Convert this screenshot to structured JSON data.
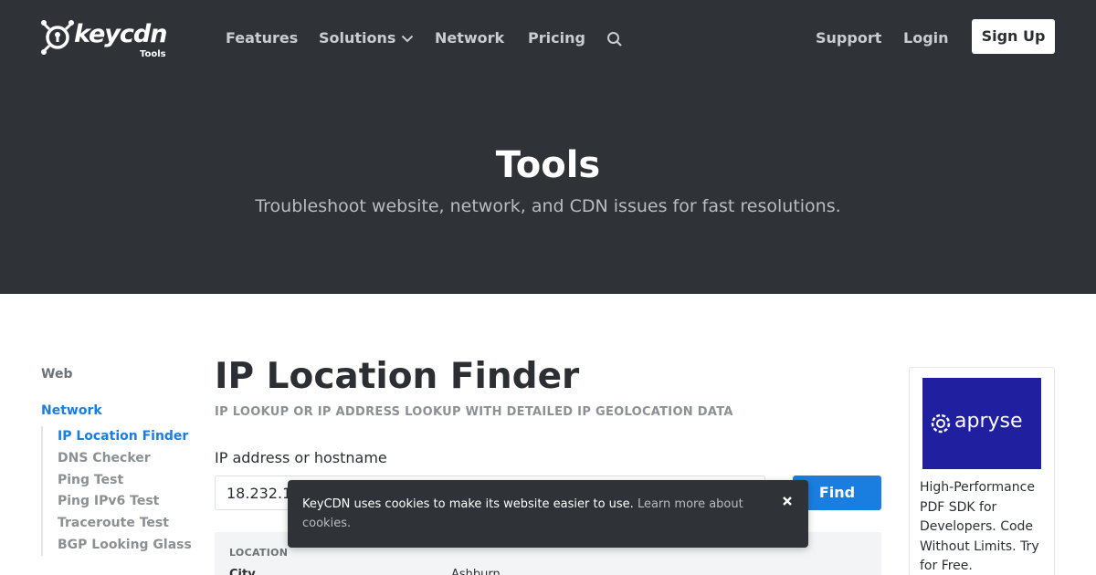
{
  "header": {
    "logo": {
      "name": "keycdn",
      "sub": "Tools"
    },
    "nav": [
      {
        "label": "Features"
      },
      {
        "label": "Solutions"
      },
      {
        "label": "Network"
      },
      {
        "label": "Pricing"
      }
    ],
    "right_nav": [
      {
        "label": "Support"
      },
      {
        "label": "Login"
      }
    ],
    "signup_label": "Sign Up",
    "icons": {
      "search": "search-icon",
      "solutions_dropdown": "chevron-down-icon"
    }
  },
  "hero": {
    "title": "Tools",
    "subtitle": "Troubleshoot website, network, and CDN issues for fast resolutions."
  },
  "sidebar": {
    "web_label": "Web",
    "network_label": "Network",
    "items": [
      {
        "label": "IP Location Finder"
      },
      {
        "label": "DNS Checker"
      },
      {
        "label": "Ping Test"
      },
      {
        "label": "Ping IPv6 Test"
      },
      {
        "label": "Traceroute Test"
      },
      {
        "label": "BGP Looking Glass"
      }
    ]
  },
  "main": {
    "title": "IP Location Finder",
    "subtitle": "IP LOOKUP OR IP ADDRESS LOOKUP WITH DETAILED IP GEOLOCATION DATA",
    "field_label": "IP address or hostname",
    "input_value": "18.232.18",
    "find_label": "Find",
    "result": {
      "section": "LOCATION",
      "key": "City",
      "value": "Ashburn"
    }
  },
  "ad": {
    "brand": "apryse",
    "text": "High-Performance PDF SDK for Developers. Code Without Limits. Try for Free."
  },
  "cookie": {
    "text": "KeyCDN uses cookies to make its website easier to use.",
    "link": "Learn more about cookies."
  },
  "colors": {
    "header_bg": "#2f3237",
    "accent": "#1a7ee0",
    "ad_bg": "#1f1fa0"
  }
}
